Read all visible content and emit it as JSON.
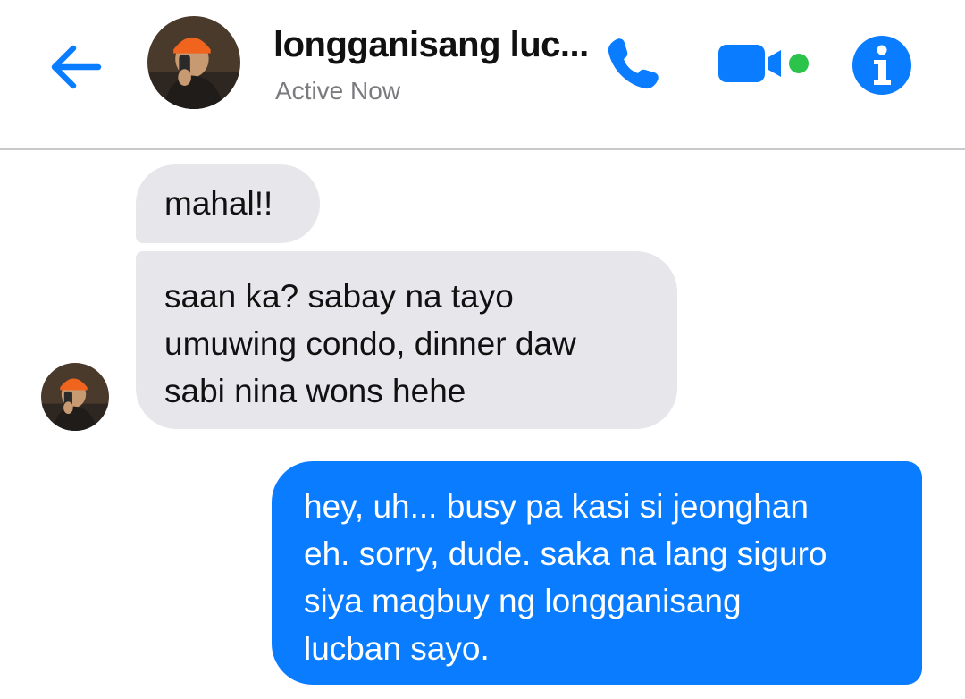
{
  "header": {
    "contact_name": "longganisang luc...",
    "status": "Active Now",
    "icons": [
      "back-arrow-icon",
      "phone-icon",
      "video-camera-icon",
      "info-icon"
    ],
    "accent_color": "#0a7cff",
    "active_dot_color": "#2bc34a"
  },
  "messages": [
    {
      "from": "contact",
      "lines": [
        "mahal!!"
      ]
    },
    {
      "from": "contact",
      "lines": [
        "saan ka? sabay na tayo",
        "umuwing condo, dinner daw",
        "sabi nina wons hehe"
      ]
    },
    {
      "from": "me",
      "lines": [
        "hey, uh... busy pa kasi si jeonghan",
        "eh. sorry, dude. saka na lang siguro",
        "siya magbuy ng longganisang",
        "lucban sayo."
      ]
    }
  ],
  "colors": {
    "received_bubble": "#e6e6eb",
    "sent_bubble": "#0a7cff"
  }
}
